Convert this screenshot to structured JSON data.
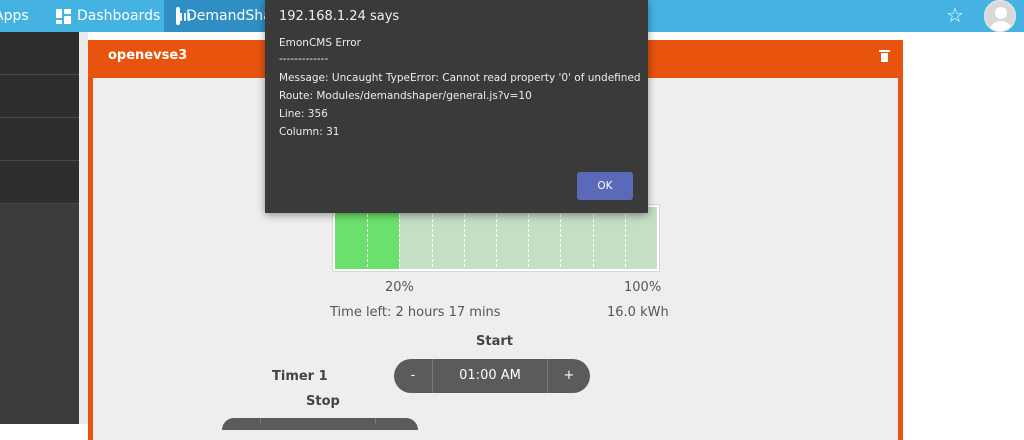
{
  "topnav": {
    "apps_label": "Apps",
    "dashboards_label": "Dashboards",
    "demandshaper_label": "DemandShaper",
    "icons": [
      "dashboards-icon",
      "calendar-icon",
      "star-icon",
      "user-avatar"
    ],
    "colors": {
      "nav_bg": "#44b3e2",
      "active_bg": "#2f8fc4"
    }
  },
  "panel": {
    "title": "openevse3",
    "accent_color": "#e8530e",
    "battery": {
      "fill_fraction": 0.2,
      "min_label": "20%",
      "max_label": "100%",
      "time_left": "Time left: 2 hours 17 mins",
      "energy": "16.0 kWh"
    },
    "timer": {
      "start_label": "Start",
      "timer_label": "Timer 1",
      "minus": "-",
      "plus": "+",
      "time_value": "01:00 AM",
      "stop_label": "Stop"
    }
  },
  "dialog": {
    "title": "192.168.1.24 says",
    "lines": [
      "EmonCMS Error",
      "-------------",
      "Message: Uncaught TypeError: Cannot read property '0' of undefined",
      "Route: Modules/demandshaper/general.js?v=10",
      "Line: 356",
      "Column: 31"
    ],
    "ok_label": "OK"
  }
}
